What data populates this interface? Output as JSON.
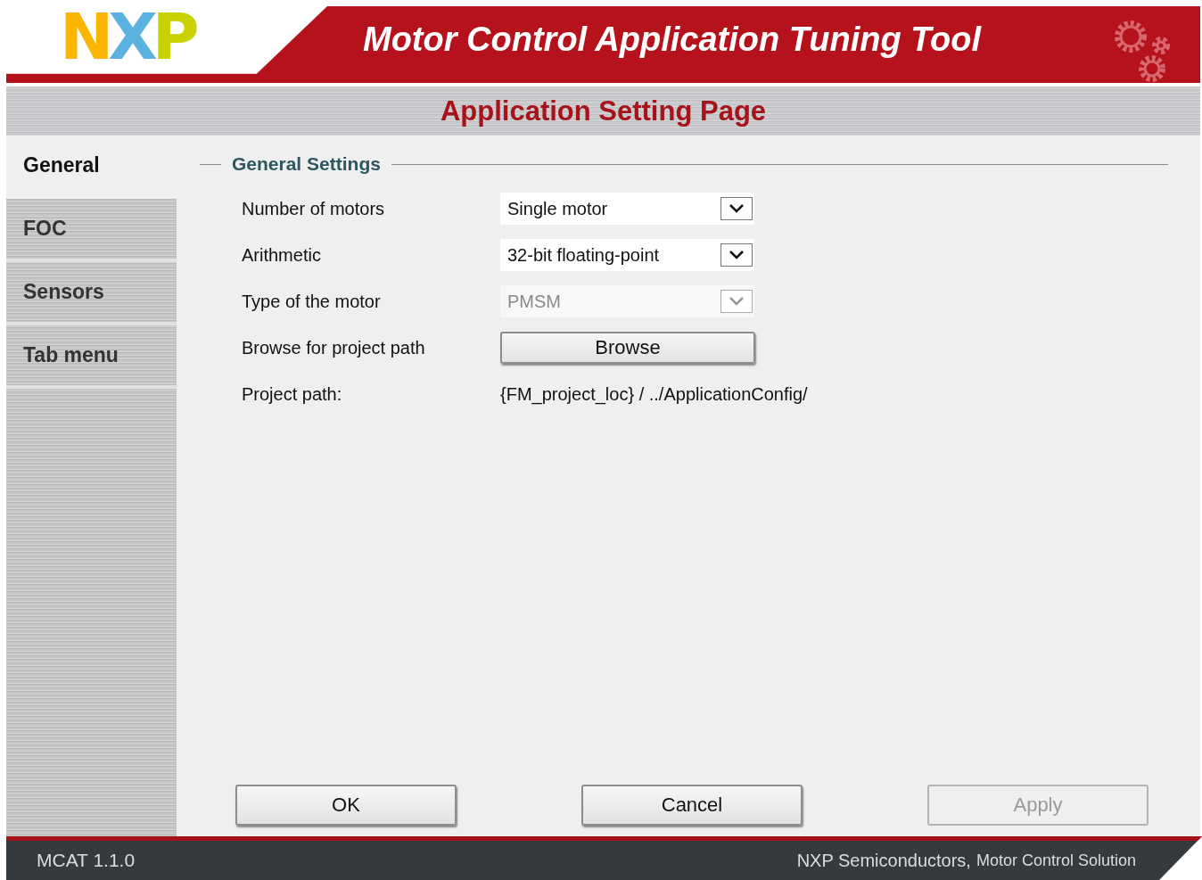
{
  "header": {
    "logo": "NXP",
    "title": "Motor Control Application Tuning Tool"
  },
  "page_title": "Application Setting Page",
  "sidebar": {
    "items": [
      {
        "label": "General",
        "selected": true
      },
      {
        "label": "FOC",
        "selected": false
      },
      {
        "label": "Sensors",
        "selected": false
      },
      {
        "label": "Tab menu",
        "selected": false
      }
    ]
  },
  "group": {
    "title": "General Settings",
    "rows": [
      {
        "kind": "dropdown",
        "label": "Number of motors",
        "value": "Single motor",
        "disabled": false
      },
      {
        "kind": "dropdown",
        "label": "Arithmetic",
        "value": "32-bit floating-point",
        "disabled": false
      },
      {
        "kind": "dropdown",
        "label": "Type of the motor",
        "value": "PMSM",
        "disabled": true
      },
      {
        "kind": "button",
        "label": "Browse for project path",
        "value": "Browse"
      },
      {
        "kind": "text",
        "label": "Project path:",
        "value": "{FM_project_loc} / ../ApplicationConfig/"
      }
    ]
  },
  "buttons": [
    {
      "label": "OK",
      "disabled": false
    },
    {
      "label": "Cancel",
      "disabled": false
    },
    {
      "label": "Apply",
      "disabled": true
    }
  ],
  "status_bar": {
    "version": "MCAT 1.1.0",
    "company": "NXP Semiconductors,",
    "product": "Motor Control Solution"
  }
}
